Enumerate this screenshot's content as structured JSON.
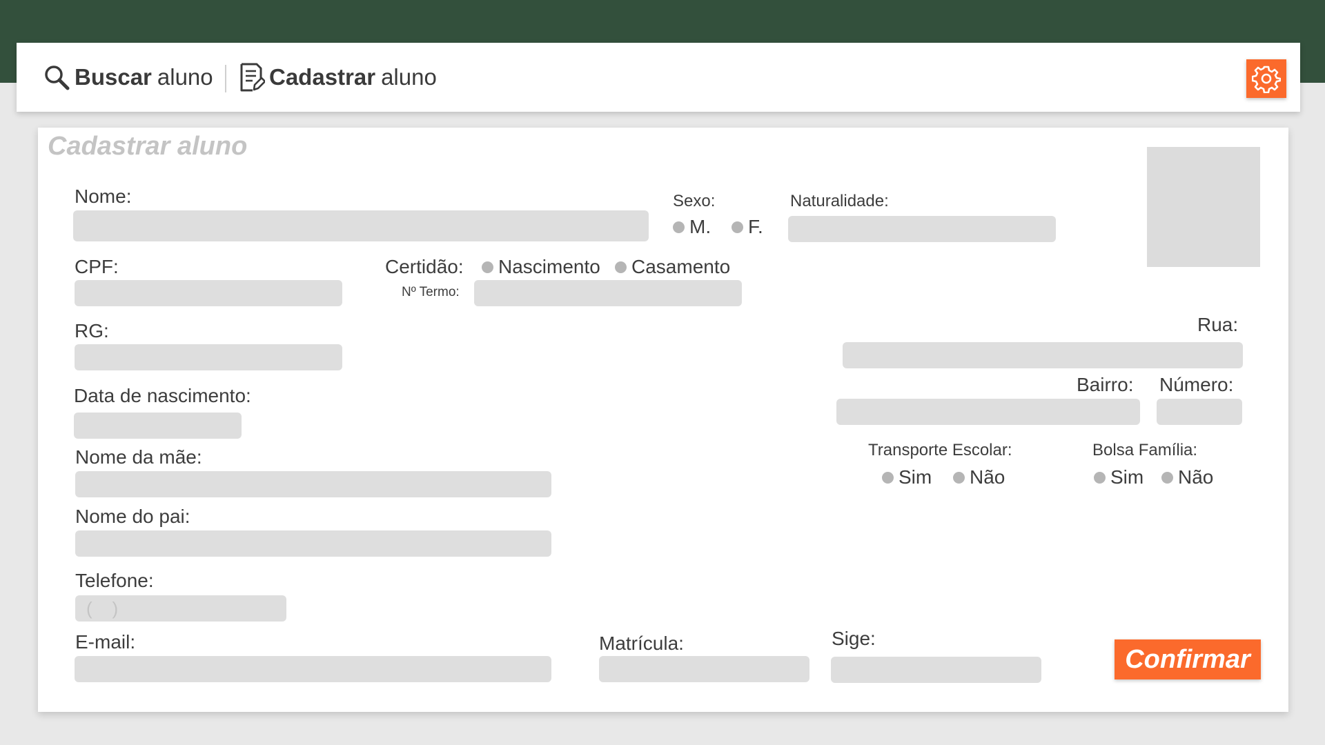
{
  "nav": {
    "search_strong": "Buscar",
    "search_rest": "aluno",
    "register_strong": "Cadastrar",
    "register_rest": "aluno"
  },
  "form": {
    "title": "Cadastrar aluno",
    "nome_label": "Nome:",
    "sexo_label": "Sexo:",
    "sexo_options": [
      "M.",
      "F."
    ],
    "naturalidade_label": "Naturalidade:",
    "cpf_label": "CPF:",
    "certidao_label": "Certidão:",
    "certidao_options": [
      "Nascimento",
      "Casamento"
    ],
    "termo_label": "Nº Termo:",
    "rg_label": "RG:",
    "rua_label": "Rua:",
    "bairro_label": "Bairro:",
    "numero_label": "Número:",
    "nascimento_label": "Data de nascimento:",
    "mae_label": "Nome da mãe:",
    "pai_label": "Nome do pai:",
    "telefone_label": "Telefone:",
    "telefone_placeholder": "(    )",
    "transporte_label": "Transporte Escolar:",
    "transporte_options": [
      "Sim",
      "Não"
    ],
    "bolsa_label": "Bolsa Família:",
    "bolsa_options": [
      "Sim",
      "Não"
    ],
    "email_label": "E-mail:",
    "matricula_label": "Matrícula:",
    "sige_label": "Sige:",
    "confirm_label": "Confirmar"
  },
  "colors": {
    "header": "#33503c",
    "accent": "#fb6a2c",
    "field": "#dedede",
    "radio": "#b5b5b5"
  },
  "icons": {
    "search": "search-icon",
    "register": "document-edit-icon",
    "settings": "gear-icon"
  }
}
